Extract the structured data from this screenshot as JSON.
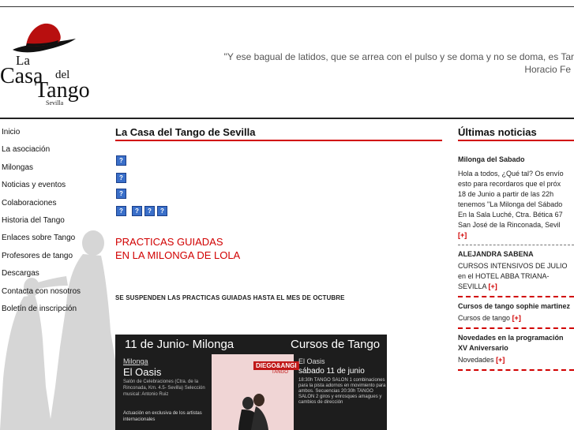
{
  "header": {
    "logo": {
      "line1": "La",
      "line2": "Casa",
      "line3": "del",
      "line4": "Tango",
      "line5": "Sevilla"
    },
    "quote_line1": "\"Y ese bagual de latidos, que se arrea con el pulso y se doma y no se doma, es Tar",
    "quote_line2": "Horacio Fe"
  },
  "nav": {
    "items": [
      "Inicio",
      "La asociación",
      "Milongas",
      "Noticias y eventos",
      "Colaboraciones",
      "Historia del Tango",
      "Enlaces sobre Tango",
      "Profesores de tango",
      "Descargas",
      "Contacta con nosotros",
      "Boletín de inscripción"
    ]
  },
  "main": {
    "title": "La Casa del Tango de Sevilla",
    "icon_glyph": "?",
    "practice_line1": "PRACTICAS GUIADAS",
    "practice_line2": "EN LA MILONGA DE LOLA",
    "notice": "SE SUSPENDEN LAS PRACTICAS GUIADAS HASTA EL MES DE OCTUBRE",
    "flyer": {
      "left_title": "11 de Junio- Milonga",
      "right_title": "Cursos de Tango",
      "milonga_label": "Milonga",
      "oasis": "El Oasis",
      "venue_text": "Salón de Celebraciones (Ctra. de la Rinconada, Km. 4.5- Sevilla) Selección musical: Antonio Ruiz",
      "performance_text": "Actuación en exclusiva de los artistas internacionales",
      "brand": "DIEGO&ANGI",
      "brand_sub": "TANGO",
      "right_oasis": "El Oasis",
      "right_date": "sábado 11 de junio",
      "right_details": "18:30h TANGO SALON 1 combinaciones para la pista adornos en movimiento para ambos. Secuencias 20:30h TANGO SALON 2 giros y enrosques amagues y cambios de dirección"
    }
  },
  "sidebar": {
    "title": "Últimas noticias",
    "more_label": "[+]",
    "news": [
      {
        "title": "Milonga del Sabado",
        "body": [
          "Hola a todos, ¿Qué tal? Os envío",
          "esto para recordaros que el próx",
          "18 de Junio a partir de las 22h",
          "tenemos \"La Milonga del Sábado",
          "En la Sala Luché, Ctra. Bética 67",
          "San José de la Rinconada, Sevil"
        ]
      },
      {
        "title": "ALEJANDRA SABENA",
        "body": [
          "CURSOS INTENSIVOS DE JULIO",
          "en el HOTEL ABBA TRIANA-",
          "SEVILLA"
        ]
      },
      {
        "title": "Cursos de tango sophie martinez",
        "body": [
          "Cursos de tango"
        ]
      },
      {
        "title": "Novedades en la programación del XV Aniversario",
        "title_line1": "Novedades en la programación",
        "title_line2": "XV Aniversario",
        "body": [
          "Novedades"
        ]
      }
    ]
  }
}
